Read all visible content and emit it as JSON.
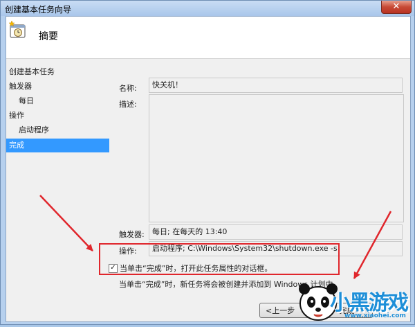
{
  "window": {
    "title": "创建基本任务向导",
    "close_glyph": "✕"
  },
  "header": {
    "title": "摘要",
    "icon": "task-clock-icon"
  },
  "sidebar": {
    "items": [
      {
        "label": "创建基本任务",
        "selected": false
      },
      {
        "label": "触发器",
        "selected": false
      },
      {
        "label": "每日",
        "selected": false
      },
      {
        "label": "操作",
        "selected": false
      },
      {
        "label": "启动程序",
        "selected": false
      },
      {
        "label": "完成",
        "selected": true
      }
    ]
  },
  "summary": {
    "name_label": "名称:",
    "name_value": "快关机！",
    "description_label": "描述:",
    "description_value": "",
    "trigger_label": "触发器:",
    "trigger_value": "每日; 在每天的 13:40",
    "action_label": "操作:",
    "action_value": "启动程序; C:\\Windows\\System32\\shutdown.exe -s"
  },
  "options": {
    "open_properties_checked": true,
    "check_glyph": "✓",
    "open_properties_label": "当单击“完成”时，打开此任务属性的对话框。",
    "info_text": "当单击“完成”时，新任务将会被创建并添加到 Windows 计划中。"
  },
  "buttons": {
    "back": "<上一步",
    "finish": "完成"
  },
  "watermark": {
    "logo": "小黑游戏",
    "url": "www.xiaohei.com",
    "brand_color": "#1e8fd8"
  },
  "colors": {
    "highlight": "#3399ff",
    "annotation_red": "#e0262c",
    "title_bar": "#b6d0ee"
  }
}
